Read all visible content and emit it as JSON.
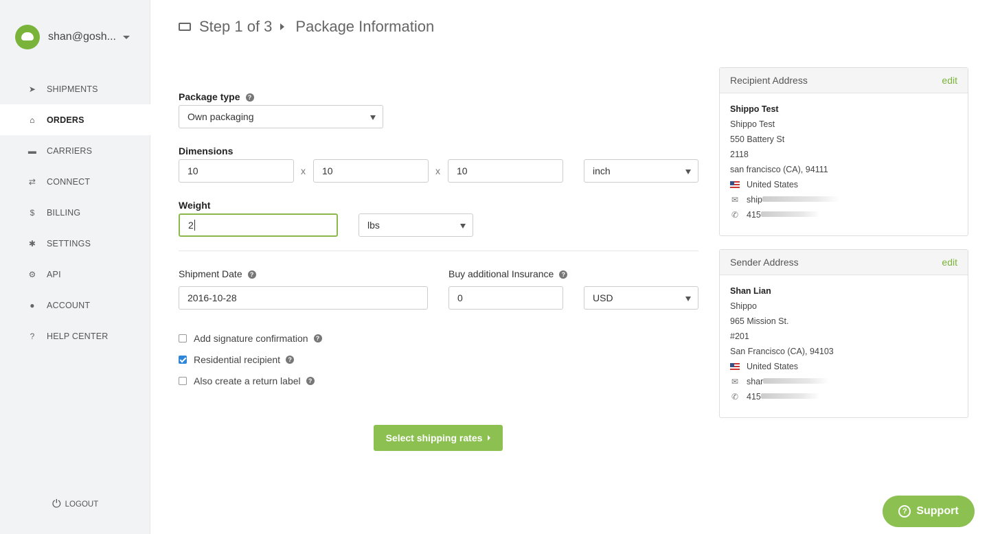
{
  "sidebar": {
    "user_name": "shan@gosh...",
    "items": [
      {
        "label": "SHIPMENTS",
        "icon": "paper-plane-icon",
        "glyph": "➤",
        "active": false
      },
      {
        "label": "ORDERS",
        "icon": "inbox-icon",
        "glyph": "⌂",
        "active": true
      },
      {
        "label": "CARRIERS",
        "icon": "truck-icon",
        "glyph": "▬",
        "active": false
      },
      {
        "label": "CONNECT",
        "icon": "exchange-icon",
        "glyph": "⇄",
        "active": false
      },
      {
        "label": "BILLING",
        "icon": "dollar-icon",
        "glyph": "$",
        "active": false
      },
      {
        "label": "SETTINGS",
        "icon": "gear-icon",
        "glyph": "✱",
        "active": false
      },
      {
        "label": "API",
        "icon": "gears-icon",
        "glyph": "⚙",
        "active": false
      },
      {
        "label": "ACCOUNT",
        "icon": "user-icon",
        "glyph": "●",
        "active": false
      },
      {
        "label": "HELP CENTER",
        "icon": "question-circle-icon",
        "glyph": "?",
        "active": false
      }
    ],
    "logout_label": "LOGOUT"
  },
  "header": {
    "step": "Step 1 of 3",
    "title": "Package Information"
  },
  "form": {
    "package_type_label": "Package type",
    "package_type_value": "Own packaging",
    "dimensions_label": "Dimensions",
    "dim_length": "10",
    "dim_width": "10",
    "dim_height": "10",
    "times": "x",
    "dim_unit": "inch",
    "weight_label": "Weight",
    "weight_value": "2",
    "weight_unit": "lbs",
    "shipment_date_label": "Shipment Date",
    "shipment_date_value": "2016-10-28",
    "insurance_label": "Buy additional Insurance",
    "insurance_value": "0",
    "insurance_currency": "USD",
    "checkboxes": [
      {
        "label": "Add signature confirmation",
        "checked": false
      },
      {
        "label": "Residential recipient",
        "checked": true
      },
      {
        "label": "Also create a return label",
        "checked": false
      }
    ],
    "submit_label": "Select shipping rates"
  },
  "recipient": {
    "title": "Recipient Address",
    "edit": "edit",
    "name": "Shippo Test",
    "company": "Shippo Test",
    "street": "550 Battery St",
    "street2": "2118",
    "city": "san francisco (CA), 94111",
    "country": "United States",
    "email": "ship",
    "phone": "415"
  },
  "sender": {
    "title": "Sender Address",
    "edit": "edit",
    "name": "Shan Lian",
    "company": "Shippo",
    "street": "965 Mission St.",
    "street2": "#201",
    "city": "San Francisco (CA), 94103",
    "country": "United States",
    "email": "shar",
    "phone": "415"
  },
  "support": {
    "label": "Support"
  },
  "colors": {
    "accent": "#8cc152",
    "link": "#7ab33a",
    "checkbox": "#2f86d9"
  }
}
